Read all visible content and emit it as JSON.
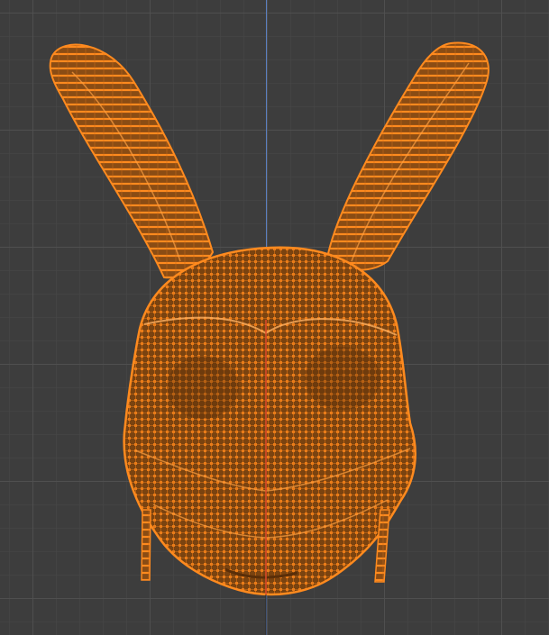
{
  "viewport": {
    "background_color": "#3d3d3d",
    "grid_color": "#505050",
    "axis_y_color": "#5a7fc0",
    "axis_x_color": "#c0392b"
  },
  "mesh": {
    "object": "bunny-head",
    "selected": true,
    "mode": "edit-wireframe",
    "wire_color": "#ff8a1e",
    "fill_color": "#6b3a0f",
    "vertex_color": "#ff7a0a"
  }
}
